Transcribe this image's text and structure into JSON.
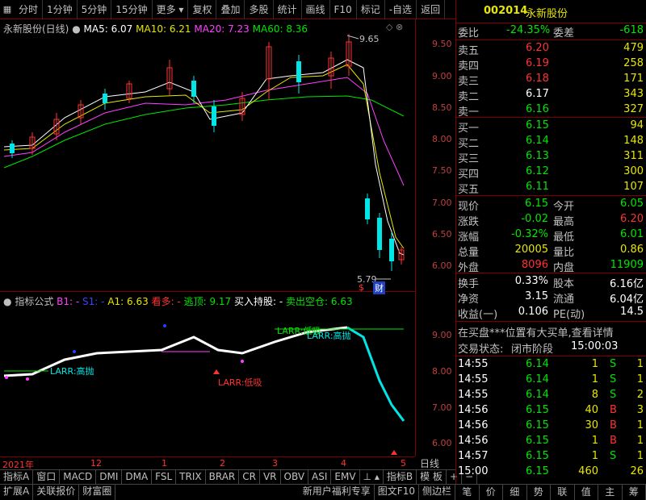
{
  "toolbar": {
    "items": [
      "分时",
      "1分钟",
      "5分钟",
      "15分钟",
      "更多",
      "复权",
      "叠加",
      "多股",
      "统计",
      "画线",
      "F10",
      "标记",
      "-自选",
      "返回"
    ]
  },
  "main_chart": {
    "title": "永新股份(日线)",
    "ma5": "MA5: 6.07",
    "ma10": "MA10: 6.21",
    "ma20": "MA20: 7.23",
    "ma60": "MA60: 8.36",
    "high_label": "9.65",
    "low_label": "5.79",
    "axis_labels": [
      "9.50",
      "9.00",
      "8.50",
      "8.00",
      "7.50",
      "7.00",
      "6.50",
      "6.00"
    ],
    "marks": [
      "$",
      "财"
    ]
  },
  "sub_chart": {
    "title": "指标公式",
    "b1": "B1: -",
    "s1": "S1: -",
    "a1": "A1: 6.63",
    "kanduo": "看多: -",
    "taoding": "逃顶: 9.17",
    "mairu": "买入持股: -",
    "maichu": "卖出空仓: 6.63",
    "axis_labels": [
      "9.00",
      "8.00",
      "7.00",
      "6.00"
    ],
    "notes": [
      "LARR:低吸",
      "LARR:高抛",
      "LARR:低吸",
      "LARR:高抛"
    ]
  },
  "date_axis": [
    "2021年",
    "12",
    "1",
    "2",
    "3",
    "4",
    "5"
  ],
  "timeframe": "日线",
  "tabs": [
    "指标A",
    "窗口",
    "MACD",
    "DMI",
    "DMA",
    "FSL",
    "TRIX",
    "BRAR",
    "CR",
    "VR",
    "OBV",
    "ASI",
    "EMV",
    "",
    "指标B",
    "模 板",
    "+",
    "−"
  ],
  "tabs2": [
    "扩展A",
    "关联报价",
    "财富圈"
  ],
  "notice": "新用户福利专享",
  "notice2": "图文F10",
  "notice3": "侧边栏",
  "stock": {
    "code": "002014",
    "name": "永新股份"
  },
  "quote": {
    "weibi_label": "委比",
    "weibi": "-24.35%",
    "weicha_label": "委差",
    "weicha": "-618",
    "asks": [
      {
        "label": "卖五",
        "price": "6.20",
        "vol": "479"
      },
      {
        "label": "卖四",
        "price": "6.19",
        "vol": "258"
      },
      {
        "label": "卖三",
        "price": "6.18",
        "vol": "171"
      },
      {
        "label": "卖二",
        "price": "6.17",
        "vol": "343"
      },
      {
        "label": "卖一",
        "price": "6.16",
        "vol": "327"
      }
    ],
    "bids": [
      {
        "label": "买一",
        "price": "6.15",
        "vol": "94"
      },
      {
        "label": "买二",
        "price": "6.14",
        "vol": "148"
      },
      {
        "label": "买三",
        "price": "6.13",
        "vol": "311"
      },
      {
        "label": "买四",
        "price": "6.12",
        "vol": "300"
      },
      {
        "label": "买五",
        "price": "6.11",
        "vol": "107"
      }
    ],
    "stats": [
      {
        "l1": "现价",
        "v1": "6.15",
        "l2": "今开",
        "v2": "6.05"
      },
      {
        "l1": "涨跌",
        "v1": "-0.02",
        "l2": "最高",
        "v2": "6.20"
      },
      {
        "l1": "涨幅",
        "v1": "-0.32%",
        "l2": "最低",
        "v2": "6.01"
      },
      {
        "l1": "总量",
        "v1": "20005",
        "l2": "量比",
        "v2": "0.86"
      },
      {
        "l1": "外盘",
        "v1": "8096",
        "l2": "内盘",
        "v2": "11909"
      }
    ],
    "stats2": [
      {
        "l1": "换手",
        "v1": "0.33%",
        "l2": "股本",
        "v2": "6.16亿"
      },
      {
        "l1": "净资",
        "v1": "3.15",
        "l2": "流通",
        "v2": "6.04亿"
      },
      {
        "l1": "收益(一)",
        "v1": "0.106",
        "l2": "PE(动)",
        "v2": "14.5"
      }
    ],
    "info": "在买盘***位置有大买单,查看详情",
    "status_label": "交易状态:",
    "status": "闭市阶段",
    "status_time": "15:00:03",
    "ticks": [
      {
        "t": "14:55",
        "p": "6.14",
        "v": "1",
        "d": "S",
        "n": "1"
      },
      {
        "t": "14:55",
        "p": "6.14",
        "v": "1",
        "d": "S",
        "n": "1"
      },
      {
        "t": "14:55",
        "p": "6.14",
        "v": "8",
        "d": "S",
        "n": "2"
      },
      {
        "t": "14:56",
        "p": "6.15",
        "v": "40",
        "d": "B",
        "n": "3"
      },
      {
        "t": "14:56",
        "p": "6.15",
        "v": "30",
        "d": "B",
        "n": "1"
      },
      {
        "t": "14:56",
        "p": "6.15",
        "v": "1",
        "d": "B",
        "n": "1"
      },
      {
        "t": "14:57",
        "p": "6.15",
        "v": "1",
        "d": "S",
        "n": "1"
      },
      {
        "t": "15:00",
        "p": "6.15",
        "v": "460",
        "d": "",
        "n": "26"
      }
    ]
  },
  "right_tabs": [
    "笔",
    "价",
    "细",
    "势",
    "联",
    "值",
    "主",
    "筹"
  ]
}
